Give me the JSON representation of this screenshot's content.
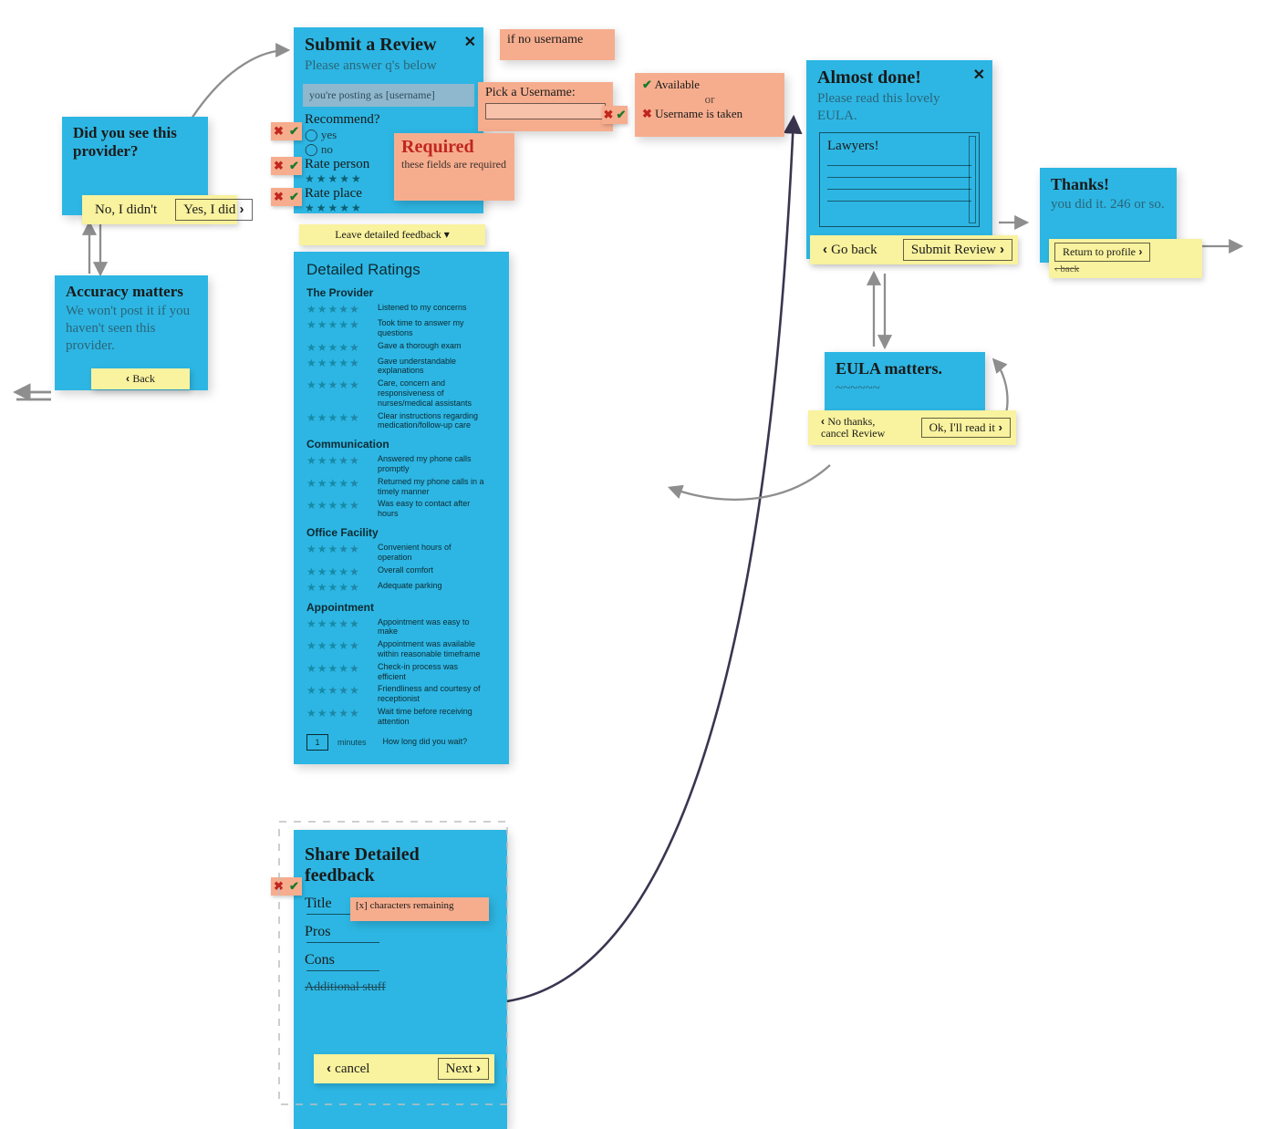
{
  "cards": {
    "see_provider": {
      "title": "Did you see this provider?",
      "action_left": "No, I didn't",
      "action_right": "Yes, I did"
    },
    "accuracy": {
      "title": "Accuracy matters",
      "body": "We won't post it if you haven't seen this provider.",
      "action": "Back"
    },
    "submit": {
      "title": "Submit a Review",
      "subtitle": "Please answer q's below",
      "posting_as": "you're posting as [username]",
      "recommend": "Recommend?",
      "opt_yes": "yes",
      "opt_no": "no",
      "rate_person": "Rate person",
      "rate_place": "Rate place"
    },
    "if_no_username": "if no username",
    "pick_username": {
      "label": "Pick a Username:"
    },
    "username_status": {
      "available": "Available",
      "taken": "Username is taken",
      "or": "or"
    },
    "required": {
      "headline": "Required",
      "body": "these fields are required"
    },
    "detailed_toggle": "Leave detailed feedback  ▾",
    "ratings": {
      "heading": "Detailed Ratings",
      "sections": [
        {
          "title": "The Provider",
          "labels": [
            "Listened to my concerns",
            "Took time to answer my questions",
            "Gave a thorough exam",
            "Gave understandable explanations",
            "Care, concern and responsiveness of nurses/medical assistants",
            "Clear instructions regarding medication/follow-up care"
          ]
        },
        {
          "title": "Communication",
          "labels": [
            "Answered my phone calls promptly",
            "Returned my phone calls in a timely manner",
            "Was easy to contact after hours"
          ]
        },
        {
          "title": "Office Facility",
          "labels": [
            "Convenient hours of operation",
            "Overall comfort",
            "Adequate parking"
          ]
        },
        {
          "title": "Appointment",
          "labels": [
            "Appointment was easy to make",
            "Appointment was available within reasonable timeframe",
            "Check-in process was efficient",
            "Friendliness and courtesy of receptionist",
            "Wait time before receiving attention"
          ]
        }
      ],
      "minutes_value": "1",
      "minutes_label": "minutes",
      "minutes_prompt": "How long did you wait?"
    },
    "share": {
      "title": "Share Detailed feedback",
      "title_label": "Title",
      "chars_remaining": "[x] characters remaining",
      "pros": "Pros",
      "cons": "Cons",
      "additional": "Additional stuff",
      "cancel": "cancel",
      "next": "Next"
    },
    "almost": {
      "title": "Almost done!",
      "body": "Please read this lovely EULA.",
      "doc_title": "Lawyers!",
      "go_back": "Go back",
      "submit": "Submit Review"
    },
    "thanks": {
      "title": "Thanks!",
      "body": "you did it. 246 or so.",
      "return": "Return to profile",
      "back": "back"
    },
    "eula": {
      "title": "EULA matters.",
      "body_scribble": "~~~~~~",
      "no_thanks": "No thanks, cancel Review",
      "ok": "Ok, I'll read it"
    }
  }
}
